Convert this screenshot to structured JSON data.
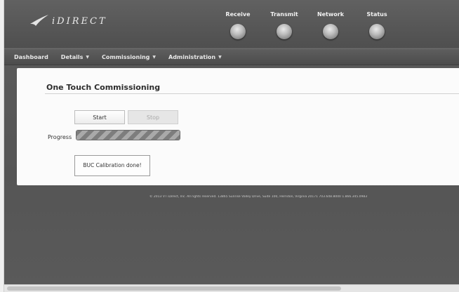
{
  "header": {
    "logo_text": "iDIRECT",
    "indicators": [
      {
        "label": "Receive"
      },
      {
        "label": "Transmit"
      },
      {
        "label": "Network"
      },
      {
        "label": "Status"
      }
    ]
  },
  "nav": {
    "items": [
      {
        "label": "Dashboard",
        "has_dropdown": false
      },
      {
        "label": "Details",
        "has_dropdown": true
      },
      {
        "label": "Commissioning",
        "has_dropdown": true
      },
      {
        "label": "Administration",
        "has_dropdown": true
      }
    ],
    "dropdown_glyph": "▼"
  },
  "panel": {
    "title": "One Touch Commissioning",
    "start_label": "Start",
    "stop_label": "Stop",
    "progress_label": "Progress",
    "progress_fraction": 1.0,
    "status_message": "BUC Calibration done!"
  },
  "footer": {
    "text": "© 2013 VT iDirect, Inc. All rights reserved. 13865 Sunrise Valley Drive, Suite 100, Herndon, Virginia 20171 703.648.8000 1.866.345.0983"
  }
}
